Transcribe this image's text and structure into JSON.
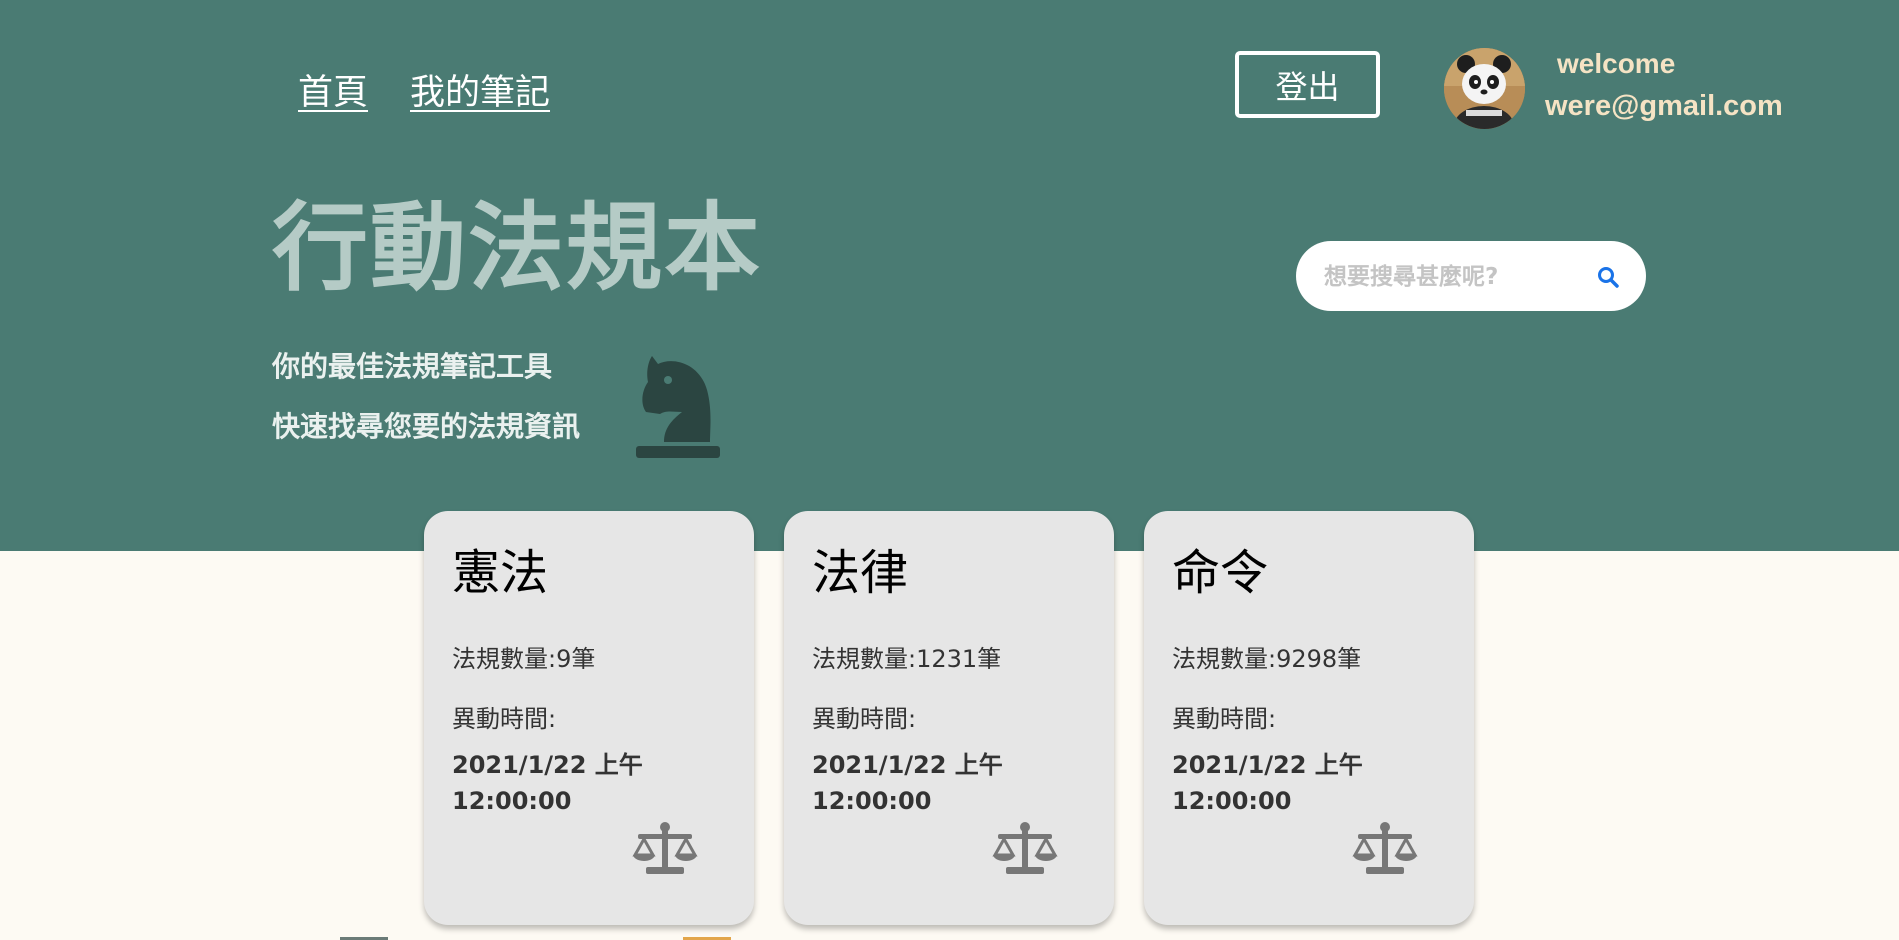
{
  "nav": {
    "home": "首頁",
    "my_notes": "我的筆記",
    "logout": "登出"
  },
  "user": {
    "welcome": "welcome",
    "email": "were@gmail.com",
    "avatar_icon": "panda-avatar"
  },
  "hero": {
    "title": "行動法規本",
    "tagline_1": "你的最佳法規筆記工具",
    "tagline_2": "快速找尋您要的法規資訊",
    "icon": "chess-knight-icon"
  },
  "search": {
    "placeholder": "想要搜尋甚麼呢?",
    "icon": "search-icon"
  },
  "cards": [
    {
      "title": "憲法",
      "count": "法規數量:9筆",
      "time_label": "異動時間:",
      "date": "2021/1/22 上午",
      "time": "12:00:00",
      "icon": "scale-icon"
    },
    {
      "title": "法律",
      "count": "法規數量:1231筆",
      "time_label": "異動時間:",
      "date": "2021/1/22 上午",
      "time": "12:00:00",
      "icon": "scale-icon"
    },
    {
      "title": "命令",
      "count": "法規數量:9298筆",
      "time_label": "異動時間:",
      "date": "2021/1/22 上午",
      "time": "12:00:00",
      "icon": "scale-icon"
    }
  ],
  "colors": {
    "hero_bg": "#4a7b73",
    "page_bg": "#fdfaf3",
    "card_bg": "#e6e6e6",
    "title_color": "#b5cbc6",
    "user_text": "#f5e3c4",
    "search_icon": "#1a73e8",
    "icon_gray": "#777777",
    "knight_dark": "#2b4541"
  }
}
